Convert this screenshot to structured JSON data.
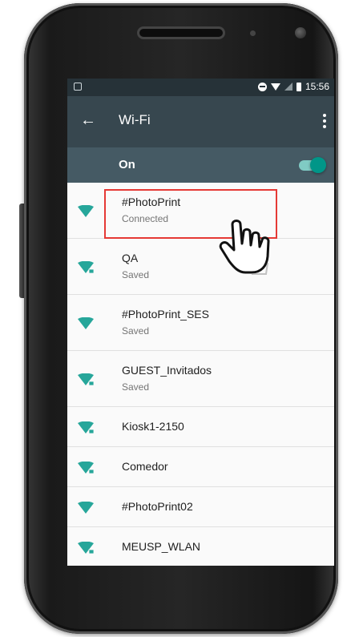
{
  "status_bar": {
    "time": "15:56",
    "icons": [
      "image-icon",
      "do-not-disturb-icon",
      "wifi-signal-icon",
      "cell-signal-icon",
      "battery-icon"
    ]
  },
  "toolbar": {
    "title": "Wi-Fi",
    "back_icon": "arrow-left-icon",
    "menu_icon": "more-vert-icon"
  },
  "wifi_switch": {
    "label": "On",
    "state": "on",
    "accent_color": "#009688"
  },
  "networks": [
    {
      "name": "#PhotoPrint",
      "status": "Connected",
      "locked": false,
      "highlighted": true
    },
    {
      "name": "QA",
      "status": "Saved",
      "locked": true
    },
    {
      "name": "#PhotoPrint_SES",
      "status": "Saved",
      "locked": false
    },
    {
      "name": "GUEST_Invitados",
      "status": "Saved",
      "locked": true
    },
    {
      "name": "Kiosk1-2150",
      "status": "",
      "locked": true
    },
    {
      "name": "Comedor",
      "status": "",
      "locked": true
    },
    {
      "name": "#PhotoPrint02",
      "status": "",
      "locked": false
    },
    {
      "name": "MEUSP_WLAN",
      "status": "",
      "locked": true
    }
  ],
  "colors": {
    "status_bar": "#263238",
    "toolbar": "#37474f",
    "switch_bar": "#455a64",
    "wifi_icon": "#26a69a",
    "highlight": "#e53935"
  },
  "annotation": {
    "cursor_icon": "hand-pointer-icon"
  }
}
